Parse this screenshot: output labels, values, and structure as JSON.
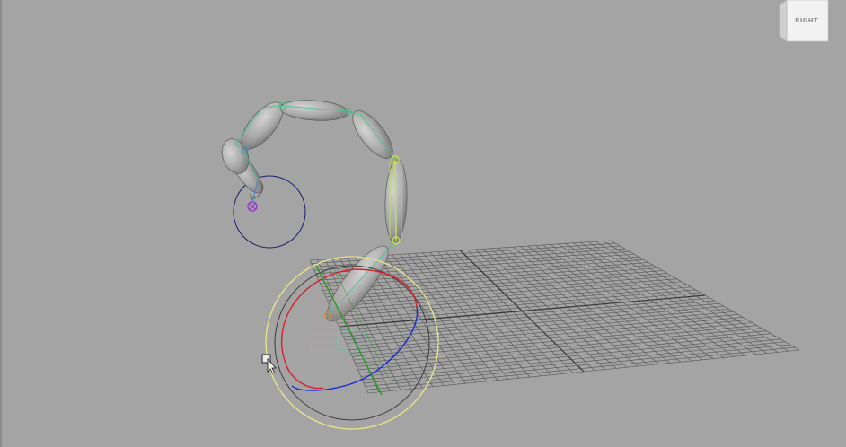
{
  "viewport": {
    "background": "#a4a4a4"
  },
  "view_cube": {
    "label": "RIGHT"
  },
  "manipulator": {
    "x_axis_color": "#d8202a",
    "y_axis_color": "#2a9a2a",
    "z_axis_color": "#1a2ad0",
    "outer_ring_color": "#e6e68a",
    "view_ring_color": "#3a3a3a"
  },
  "joint_colors": {
    "selected": "#c8e83a",
    "chain": "#39c48a",
    "end": "#4a7fc8",
    "ik_handle": "#8a3ab8",
    "controller": "#1a1a6e"
  }
}
